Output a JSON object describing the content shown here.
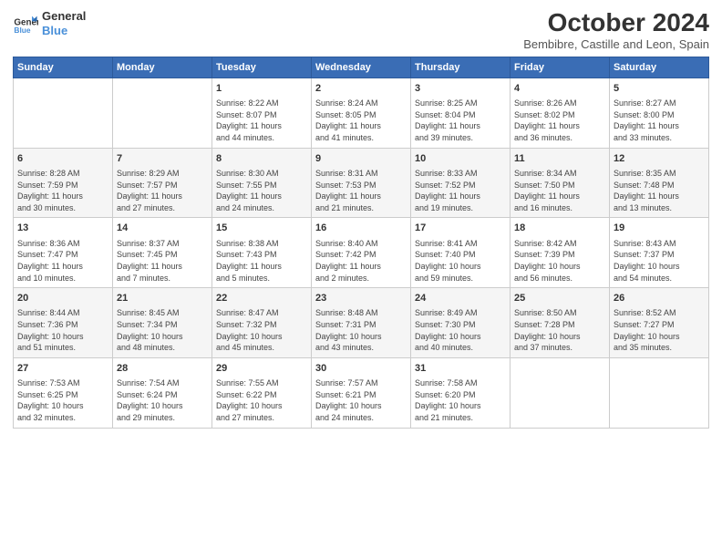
{
  "header": {
    "logo_line1": "General",
    "logo_line2": "Blue",
    "month": "October 2024",
    "location": "Bembibre, Castille and Leon, Spain"
  },
  "weekdays": [
    "Sunday",
    "Monday",
    "Tuesday",
    "Wednesday",
    "Thursday",
    "Friday",
    "Saturday"
  ],
  "weeks": [
    [
      {
        "day": "",
        "info": ""
      },
      {
        "day": "",
        "info": ""
      },
      {
        "day": "1",
        "info": "Sunrise: 8:22 AM\nSunset: 8:07 PM\nDaylight: 11 hours\nand 44 minutes."
      },
      {
        "day": "2",
        "info": "Sunrise: 8:24 AM\nSunset: 8:05 PM\nDaylight: 11 hours\nand 41 minutes."
      },
      {
        "day": "3",
        "info": "Sunrise: 8:25 AM\nSunset: 8:04 PM\nDaylight: 11 hours\nand 39 minutes."
      },
      {
        "day": "4",
        "info": "Sunrise: 8:26 AM\nSunset: 8:02 PM\nDaylight: 11 hours\nand 36 minutes."
      },
      {
        "day": "5",
        "info": "Sunrise: 8:27 AM\nSunset: 8:00 PM\nDaylight: 11 hours\nand 33 minutes."
      }
    ],
    [
      {
        "day": "6",
        "info": "Sunrise: 8:28 AM\nSunset: 7:59 PM\nDaylight: 11 hours\nand 30 minutes."
      },
      {
        "day": "7",
        "info": "Sunrise: 8:29 AM\nSunset: 7:57 PM\nDaylight: 11 hours\nand 27 minutes."
      },
      {
        "day": "8",
        "info": "Sunrise: 8:30 AM\nSunset: 7:55 PM\nDaylight: 11 hours\nand 24 minutes."
      },
      {
        "day": "9",
        "info": "Sunrise: 8:31 AM\nSunset: 7:53 PM\nDaylight: 11 hours\nand 21 minutes."
      },
      {
        "day": "10",
        "info": "Sunrise: 8:33 AM\nSunset: 7:52 PM\nDaylight: 11 hours\nand 19 minutes."
      },
      {
        "day": "11",
        "info": "Sunrise: 8:34 AM\nSunset: 7:50 PM\nDaylight: 11 hours\nand 16 minutes."
      },
      {
        "day": "12",
        "info": "Sunrise: 8:35 AM\nSunset: 7:48 PM\nDaylight: 11 hours\nand 13 minutes."
      }
    ],
    [
      {
        "day": "13",
        "info": "Sunrise: 8:36 AM\nSunset: 7:47 PM\nDaylight: 11 hours\nand 10 minutes."
      },
      {
        "day": "14",
        "info": "Sunrise: 8:37 AM\nSunset: 7:45 PM\nDaylight: 11 hours\nand 7 minutes."
      },
      {
        "day": "15",
        "info": "Sunrise: 8:38 AM\nSunset: 7:43 PM\nDaylight: 11 hours\nand 5 minutes."
      },
      {
        "day": "16",
        "info": "Sunrise: 8:40 AM\nSunset: 7:42 PM\nDaylight: 11 hours\nand 2 minutes."
      },
      {
        "day": "17",
        "info": "Sunrise: 8:41 AM\nSunset: 7:40 PM\nDaylight: 10 hours\nand 59 minutes."
      },
      {
        "day": "18",
        "info": "Sunrise: 8:42 AM\nSunset: 7:39 PM\nDaylight: 10 hours\nand 56 minutes."
      },
      {
        "day": "19",
        "info": "Sunrise: 8:43 AM\nSunset: 7:37 PM\nDaylight: 10 hours\nand 54 minutes."
      }
    ],
    [
      {
        "day": "20",
        "info": "Sunrise: 8:44 AM\nSunset: 7:36 PM\nDaylight: 10 hours\nand 51 minutes."
      },
      {
        "day": "21",
        "info": "Sunrise: 8:45 AM\nSunset: 7:34 PM\nDaylight: 10 hours\nand 48 minutes."
      },
      {
        "day": "22",
        "info": "Sunrise: 8:47 AM\nSunset: 7:32 PM\nDaylight: 10 hours\nand 45 minutes."
      },
      {
        "day": "23",
        "info": "Sunrise: 8:48 AM\nSunset: 7:31 PM\nDaylight: 10 hours\nand 43 minutes."
      },
      {
        "day": "24",
        "info": "Sunrise: 8:49 AM\nSunset: 7:30 PM\nDaylight: 10 hours\nand 40 minutes."
      },
      {
        "day": "25",
        "info": "Sunrise: 8:50 AM\nSunset: 7:28 PM\nDaylight: 10 hours\nand 37 minutes."
      },
      {
        "day": "26",
        "info": "Sunrise: 8:52 AM\nSunset: 7:27 PM\nDaylight: 10 hours\nand 35 minutes."
      }
    ],
    [
      {
        "day": "27",
        "info": "Sunrise: 7:53 AM\nSunset: 6:25 PM\nDaylight: 10 hours\nand 32 minutes."
      },
      {
        "day": "28",
        "info": "Sunrise: 7:54 AM\nSunset: 6:24 PM\nDaylight: 10 hours\nand 29 minutes."
      },
      {
        "day": "29",
        "info": "Sunrise: 7:55 AM\nSunset: 6:22 PM\nDaylight: 10 hours\nand 27 minutes."
      },
      {
        "day": "30",
        "info": "Sunrise: 7:57 AM\nSunset: 6:21 PM\nDaylight: 10 hours\nand 24 minutes."
      },
      {
        "day": "31",
        "info": "Sunrise: 7:58 AM\nSunset: 6:20 PM\nDaylight: 10 hours\nand 21 minutes."
      },
      {
        "day": "",
        "info": ""
      },
      {
        "day": "",
        "info": ""
      }
    ]
  ]
}
